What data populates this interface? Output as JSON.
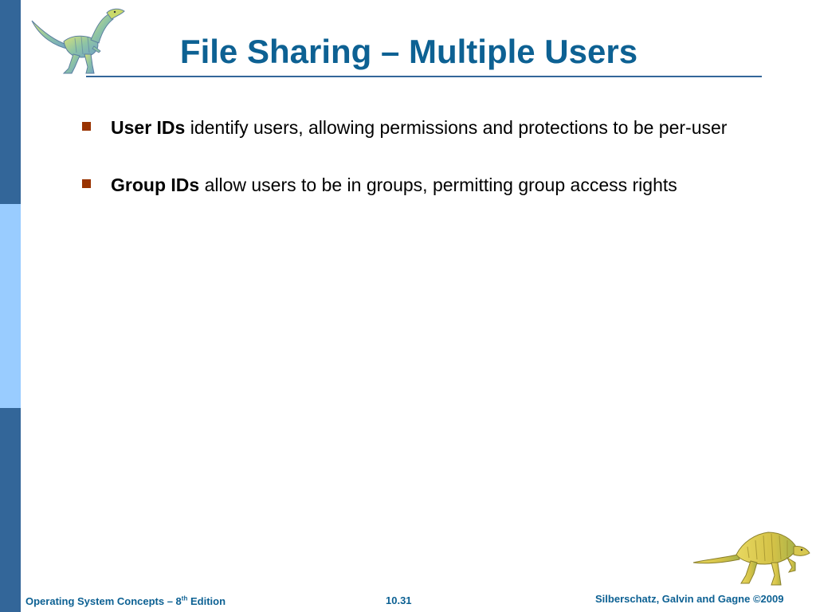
{
  "slide": {
    "title": "File Sharing – Multiple Users",
    "bullets": [
      {
        "term": "User IDs",
        "text": "identify users, allowing permissions and protections to be per-user"
      },
      {
        "term": "Group IDs",
        "text": "allow users to be in groups, permitting group access rights"
      }
    ]
  },
  "footer": {
    "left_prefix": "Operating System Concepts – 8",
    "left_sup": "th",
    "left_suffix": "Edition",
    "center": "10.31",
    "right": "Silberschatz, Galvin and Gagne ©2009"
  },
  "icons": {
    "top_logo": "dinosaur-icon",
    "bottom_logo": "dinosaur-icon"
  },
  "colors": {
    "title": "#0d6193",
    "sidebar_dark": "#336699",
    "sidebar_light": "#99ccff",
    "bullet_marker": "#993300",
    "footer_text": "#0d6193"
  }
}
